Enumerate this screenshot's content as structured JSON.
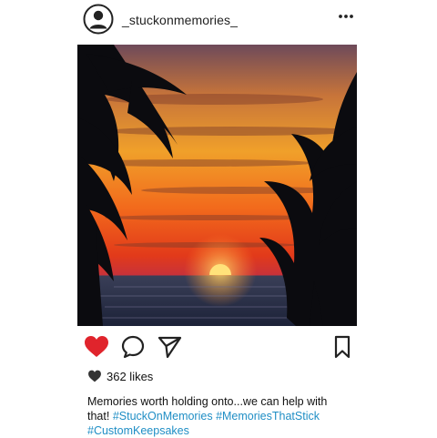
{
  "post": {
    "username": "_stuckonmemories_",
    "likes_count": "362 likes",
    "caption_text": "Memories worth holding onto...we can help with that!",
    "hashtags": [
      "#StuckOnMemories",
      "#MemoriesThatStick",
      "#CustomKeepsakes"
    ]
  },
  "icons": {
    "avatar": "user-circle-icon",
    "more": "more-options-icon",
    "like": "heart-filled-icon",
    "comment": "comment-icon",
    "share": "send-icon",
    "save": "bookmark-icon",
    "likes": "heart-small-icon"
  },
  "colors": {
    "like_heart": "#e0242c",
    "hashtag": "#1f8ec5",
    "text": "#111111"
  }
}
